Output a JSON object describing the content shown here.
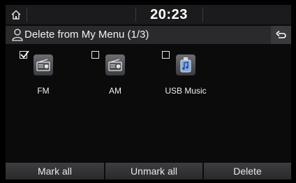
{
  "status": {
    "time": "20:23"
  },
  "header": {
    "title": "Delete from My Menu (1/3)"
  },
  "items": [
    {
      "label": "FM",
      "checked": true,
      "icon": "radio-icon"
    },
    {
      "label": "AM",
      "checked": false,
      "icon": "radio-icon"
    },
    {
      "label": "USB Music",
      "checked": false,
      "icon": "usb-music-icon"
    }
  ],
  "buttons": {
    "mark_all": "Mark all",
    "unmark_all": "Unmark all",
    "delete": "Delete"
  }
}
